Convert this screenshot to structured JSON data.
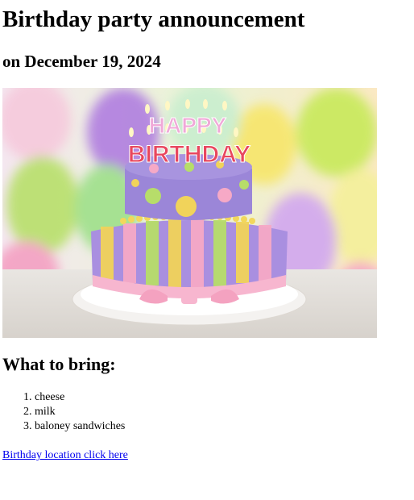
{
  "page": {
    "title": "Birthday party announcement",
    "subtitle": "on December 19, 2024"
  },
  "image": {
    "icon": "birthday-cake-photo",
    "topper_line1": "HAPPY",
    "topper_line2": "BIRTHDAY",
    "colors": {
      "cake_top": "#9b86d8",
      "cake_bottom": "#a98fe0",
      "stripe_yellow": "#f1d35a",
      "stripe_pink": "#f6a9c6",
      "stripe_green": "#b7dd6a",
      "ribbon": "#f7b6cf"
    }
  },
  "bring": {
    "heading": "What to bring:",
    "items": [
      "cheese",
      "milk",
      "baloney sandwiches"
    ]
  },
  "link": {
    "label": "Birthday location click here"
  }
}
